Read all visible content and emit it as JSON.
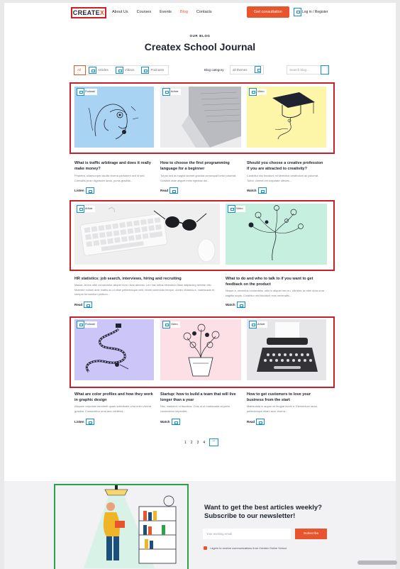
{
  "header": {
    "logo": "CREATE",
    "logo_x": "X",
    "nav": [
      "About Us",
      "Courses",
      "Events",
      "Blog",
      "Contacts"
    ],
    "active_nav": "Blog",
    "cta": "Get consultation",
    "login": "Log in / Register"
  },
  "hero": {
    "eyebrow": "OUR BLOG",
    "title": "Createx School Journal"
  },
  "filters": {
    "tabs": [
      "All",
      "Articles",
      "Videos",
      "Podcasts"
    ],
    "active_tab": "All",
    "category_label": "Blog category",
    "category_value": "all themes",
    "search_placeholder": "Search blog..."
  },
  "cards": [
    {
      "badge": "Podcast",
      "title": "What is traffic arbitrage and does it really make money?",
      "desc": "Pharetra, ullamcorper iaculis viverra parturient sed id sed. Convallis proin dignissim lacus, purus gravida...",
      "action": "Listen"
    },
    {
      "badge": "Article",
      "title": "How to choose the first programming language for a beginner",
      "desc": "Turpis sed at magna laoreet gravida consequat tortor placerat. Gravida vitae aliquet enim egestas dui...",
      "action": "Read"
    },
    {
      "badge": "Video",
      "title": "Should you choose a creative profession if you are attracted to creativity?",
      "desc": "Curabitur nisi tincidunt mi senectus vestibulum ac placerat. Tortor, viverra vel vulputate ultrices...",
      "action": "Watch"
    },
    {
      "badge": "Article",
      "title": "HR statistics: job search, interviews, hiring and recruiting",
      "desc": "Massa, lectus nibh consectetur aliquet nunc risus aenean. Leo hac netus bibendum diam adipiscing aenean nisi. Molestie nullam ante mattis ac ut vitae pellentesque velit. Morbi commodo tempor, donec vivamus a, malesuada id sempre fermentum pretium...",
      "action": "Read"
    },
    {
      "badge": "Video",
      "title": "What to do and who to talk to if you want to get feedback on the product",
      "desc": "Neque a, senectus consectetur odio in aliquet nec eu. Ultricies ac nibh urna urna sagittis turpis. Curabitur nisl tincidunt eros venenatis...",
      "action": "Watch"
    },
    {
      "badge": "Podcast",
      "title": "What are color profiles and how they work in graphic design",
      "desc": "Aliquam vulputate hendrerit quam sollicitudin urna enim viverra gravida. Consectetur urna arcu eleifend...",
      "action": "Listen"
    },
    {
      "badge": "Video",
      "title": "Startup: how to build a team that will live longer than a year",
      "desc": "Nisi, massa ut ut faucibus. Cras ut ut malesuada at porta consectetur imperdiet...",
      "action": "Watch"
    },
    {
      "badge": "Article",
      "title": "How to get customers to love your business from the start",
      "desc": "Malesuada in augue mi feugiat morbi a. Elementum lacus, pellentesque etiam arcu viverra...",
      "action": "Read"
    }
  ],
  "pagination": {
    "pages": [
      "1",
      "2",
      "3",
      "4"
    ]
  },
  "newsletter": {
    "title": "Want to get the best articles weekly? Subscribe to our newsletter!",
    "input_placeholder": "Your working email",
    "button": "Subscribe",
    "consent": "I agree to receive communications from Createx Online School"
  },
  "colors": {
    "accent": "#e8542b",
    "row_outline": "#c8202a",
    "illustration_outline": "#2da04a",
    "icon_outline": "#1491d6"
  }
}
